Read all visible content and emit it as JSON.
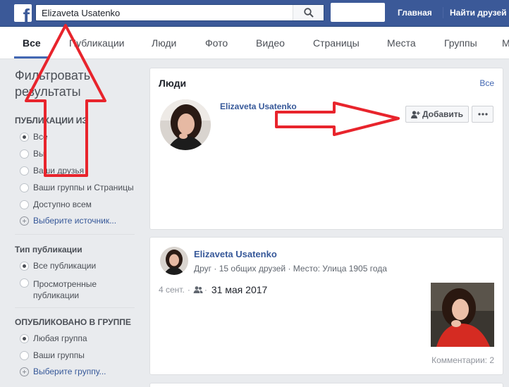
{
  "header": {
    "logo_letter": "f",
    "search_value": "Elizaveta Usatenko",
    "nav": [
      "Главная",
      "Найти друзей"
    ]
  },
  "tabs": [
    "Все",
    "Публикации",
    "Люди",
    "Фото",
    "Видео",
    "Страницы",
    "Места",
    "Группы",
    "М"
  ],
  "sidebar": {
    "title": "Фильтровать результаты",
    "publications_from": {
      "heading": "ПУБЛИКАЦИИ ИЗ",
      "options": [
        "Все",
        "Вы",
        "Ваши друзья",
        "Ваши группы и Страницы",
        "Доступно всем"
      ],
      "selected": 0,
      "choose": "Выберите источник..."
    },
    "post_type": {
      "heading": "Тип публикации",
      "options": [
        "Все публикации",
        "Просмотренные публикации"
      ],
      "selected": 0
    },
    "posted_in_group": {
      "heading": "ОПУБЛИКОВАНО В ГРУППЕ",
      "options": [
        "Любая группа",
        "Ваши группы"
      ],
      "selected": 0,
      "choose": "Выберите группу..."
    }
  },
  "people_card": {
    "heading": "Люди",
    "see_all": "Все",
    "name": "Elizaveta Usatenko",
    "add_label": "Добавить"
  },
  "post_card": {
    "name": "Elizaveta Usatenko",
    "meta": "Друг · 15 общих друзей · Место: Улица 1905 года",
    "short_date": "4 сент.",
    "date": "31 мая 2017",
    "comments": "Комментарии: 2"
  },
  "colors": {
    "brand": "#3b5998",
    "link": "#365899",
    "annotation": "#e8242c"
  }
}
